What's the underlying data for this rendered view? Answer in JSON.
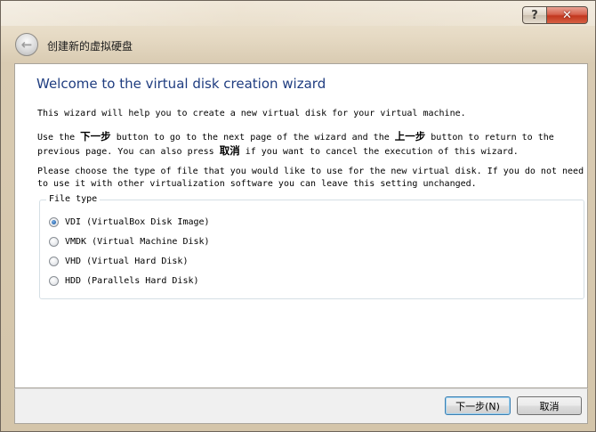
{
  "window": {
    "title": "创建新的虚拟硬盘",
    "help_label": "?",
    "close_label": "✕",
    "back_icon": "back-arrow-icon"
  },
  "wizard": {
    "heading": "Welcome to the virtual disk creation wizard",
    "intro": "This wizard will help you to create a new virtual disk for your virtual machine.",
    "nav_text": {
      "part1": "Use the ",
      "next_term": "下一步",
      "part2": " button to go to the next page of the wizard and the ",
      "back_term": "上一步",
      "part3": " button to return to the previous page. You can also press ",
      "cancel_term": "取消",
      "part4": " if you want to cancel the execution of this wizard."
    },
    "choose_text": "Please choose the type of file that you would like to use for the new virtual disk. If you do not need to use it with other virtualization software you can leave this setting unchanged.",
    "file_type": {
      "legend": "File type",
      "selected": "VDI",
      "options": [
        {
          "label": "VDI (VirtualBox Disk Image)",
          "checked": true
        },
        {
          "label": "VMDK (Virtual Machine Disk)",
          "checked": false
        },
        {
          "label": "VHD (Virtual Hard Disk)",
          "checked": false
        },
        {
          "label": "HDD (Parallels Hard Disk)",
          "checked": false
        }
      ]
    }
  },
  "buttons": {
    "next_label": "下一步(N)",
    "cancel_label": "取消"
  },
  "colors": {
    "heading": "#1f3d80",
    "close_button": "#c2371e",
    "default_button_border": "#3c7fb1"
  }
}
